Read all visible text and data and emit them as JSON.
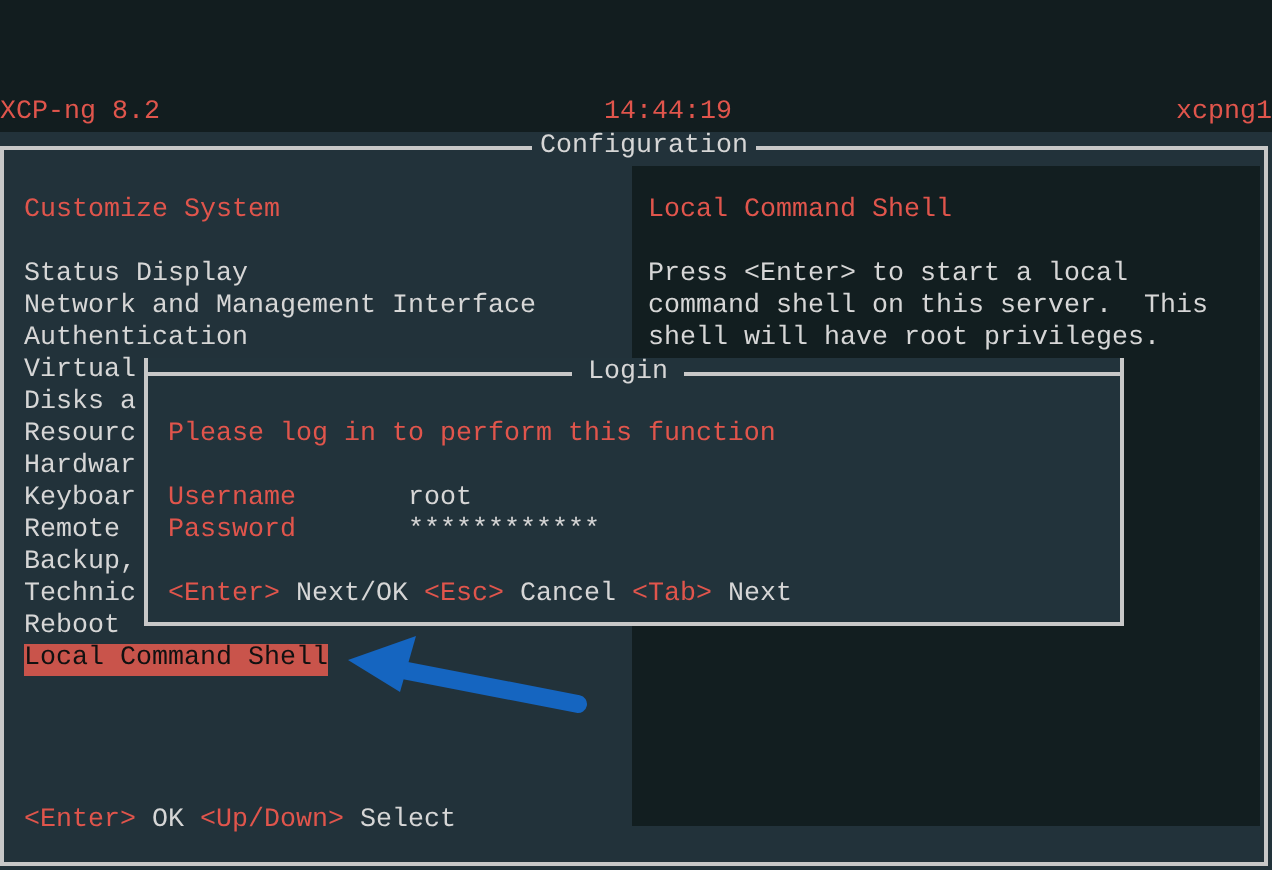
{
  "header": {
    "product": "XCP-ng 8.2",
    "time": "14:44:19",
    "host": "xcpng1"
  },
  "window": {
    "title": "Configuration"
  },
  "menu": {
    "title": "Customize System",
    "items": [
      {
        "label": "Status Display",
        "selected": false
      },
      {
        "label": "Network and Management Interface",
        "selected": false
      },
      {
        "label": "Authentication",
        "selected": false
      },
      {
        "label": "Virtual",
        "selected": false
      },
      {
        "label": "Disks a",
        "selected": false
      },
      {
        "label": "Resourc",
        "selected": false
      },
      {
        "label": "Hardwar",
        "selected": false
      },
      {
        "label": "Keyboar",
        "selected": false
      },
      {
        "label": "Remote",
        "selected": false
      },
      {
        "label": "Backup,",
        "selected": false
      },
      {
        "label": "Technic",
        "selected": false
      },
      {
        "label": "Reboot",
        "selected": false
      },
      {
        "label": "Local Command Shell",
        "selected": true
      }
    ],
    "hints": [
      {
        "key": "<Enter>",
        "action": "OK"
      },
      {
        "key": "<Up/Down>",
        "action": "Select"
      }
    ]
  },
  "detail": {
    "title": "Local Command Shell",
    "lines": [
      "Press <Enter> to start a local",
      "command shell on this server.  This",
      "shell will have root privileges."
    ]
  },
  "dialog": {
    "title": "Login",
    "message": "Please log in to perform this function",
    "fields": [
      {
        "label": "Username",
        "value": "root"
      },
      {
        "label": "Password",
        "value": "************"
      }
    ],
    "hints": [
      {
        "key": "<Enter>",
        "action": "Next/OK"
      },
      {
        "key": "<Esc>",
        "action": "Cancel"
      },
      {
        "key": "<Tab>",
        "action": "Next"
      }
    ]
  }
}
